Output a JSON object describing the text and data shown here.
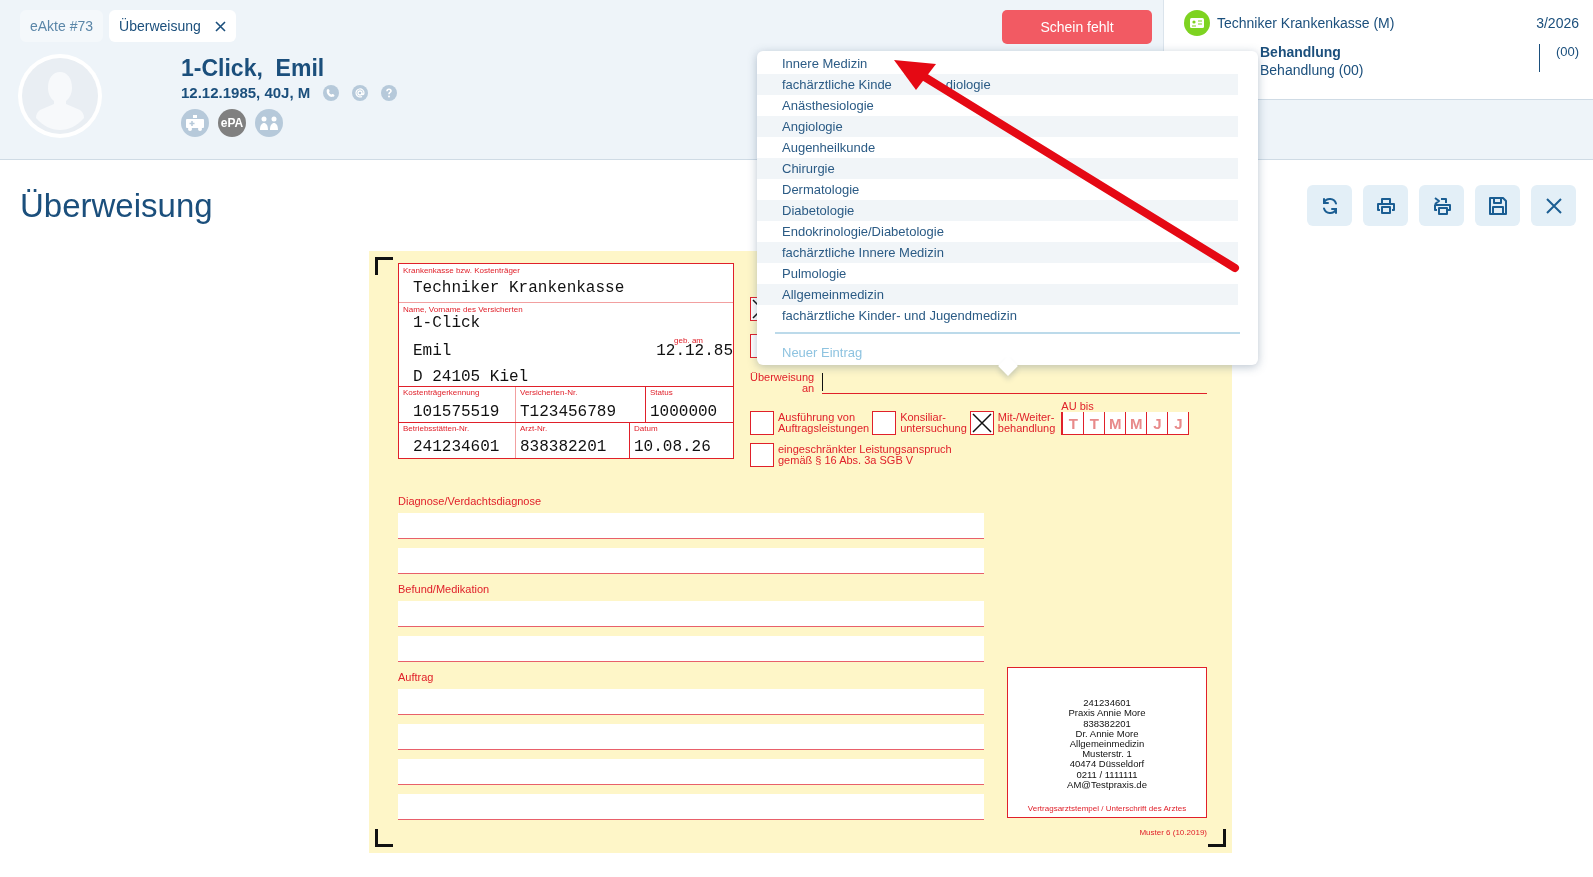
{
  "tabs": [
    {
      "label": "eAkte #73",
      "selected": false,
      "closable": false
    },
    {
      "label": "Überweisung",
      "selected": true,
      "closable": true
    }
  ],
  "patient": {
    "name": "1-Click,  Emil",
    "info": "12.12.1985, 40J, M",
    "epa_badge": "ePA"
  },
  "alert_button": "Schein fehlt",
  "insurance_panel": {
    "insurer": "Techniker Krankenkasse (M)",
    "quarter": "3/2026",
    "case_title": "Behandlung",
    "case_subtitle": "Behandlung (00)",
    "case_code": "(00)"
  },
  "page_title": "Überweisung",
  "form": {
    "insurer_label": "Krankenkasse bzw. Kostenträger",
    "insurer": "Techniker Krankenkasse",
    "name_label": "Name, Vorname des Versicherten",
    "surname": "1-Click",
    "first_name": "Emil",
    "birth_label": "geb. am",
    "birth_date": "12.12.85",
    "address": "D 24105 Kiel",
    "ids_row": [
      {
        "label": "Kostenträgerkennung",
        "value": "101575519"
      },
      {
        "label": "Versicherten-Nr.",
        "value": "T123456789"
      },
      {
        "label": "Status",
        "value": "1000000"
      }
    ],
    "practice_row": [
      {
        "label": "Betriebsstätten-Nr.",
        "value": "241234601"
      },
      {
        "label": "Arzt-Nr.",
        "value": "838382201"
      },
      {
        "label": "Datum",
        "value": "10.08.26"
      }
    ],
    "top_checkboxes": [
      {
        "checked": true
      },
      {
        "checked": false
      }
    ],
    "referral_label": "Überweisung\nan",
    "options": [
      {
        "label": "Ausführung von\nAuftragsleistungen",
        "checked": false
      },
      {
        "label": "Konsiliar-\nuntersuchung",
        "checked": false
      },
      {
        "label": "Mit-/Weiter-\nbehandlung",
        "checked": true
      }
    ],
    "au_label": "AU bis",
    "au_boxes": [
      "T",
      "T",
      "M",
      "M",
      "J",
      "J"
    ],
    "restriction": {
      "label": "eingeschränkter Leistungsanspruch\ngemäß § 16 Abs. 3a SGB V",
      "checked": false
    },
    "sections": [
      {
        "label": "Diagnose/Verdachtsdiagnose"
      },
      {
        "label": "Befund/Medikation"
      },
      {
        "label": "Auftrag"
      }
    ],
    "stamp_lines": [
      "241234601",
      "Praxis Annie More",
      "838382201",
      "Dr. Annie More",
      "Allgemeinmedizin",
      "Musterstr. 1",
      "40474 Düsseldorf",
      "0211 / 1111111",
      "AM@Testpraxis.de"
    ],
    "stamp_caption": "Vertragsarztstempel / Unterschrift des Arztes",
    "form_code": "Muster 6 (10.2019)"
  },
  "dropdown": {
    "items": [
      {
        "parts": [
          "Innere Medizin"
        ]
      },
      {
        "parts": [
          "fachärztliche Kinde",
          "diologie"
        ]
      },
      {
        "parts": [
          "Anästhesiologie"
        ]
      },
      {
        "parts": [
          "Angiologie"
        ]
      },
      {
        "parts": [
          "Augenheilkunde"
        ]
      },
      {
        "parts": [
          "Chirurgie"
        ]
      },
      {
        "parts": [
          "Dermatologie"
        ]
      },
      {
        "parts": [
          "Diabetologie"
        ]
      },
      {
        "parts": [
          "Endokrinologie/Diabetologie"
        ]
      },
      {
        "parts": [
          "fachärztliche Innere Medizin"
        ]
      },
      {
        "parts": [
          "Pulmologie"
        ]
      },
      {
        "parts": [
          "Allgemeinmedizin"
        ]
      },
      {
        "parts": [
          "fachärztliche Kinder- und Jugendmedizin"
        ]
      }
    ],
    "new_entry": "Neuer Eintrag"
  }
}
